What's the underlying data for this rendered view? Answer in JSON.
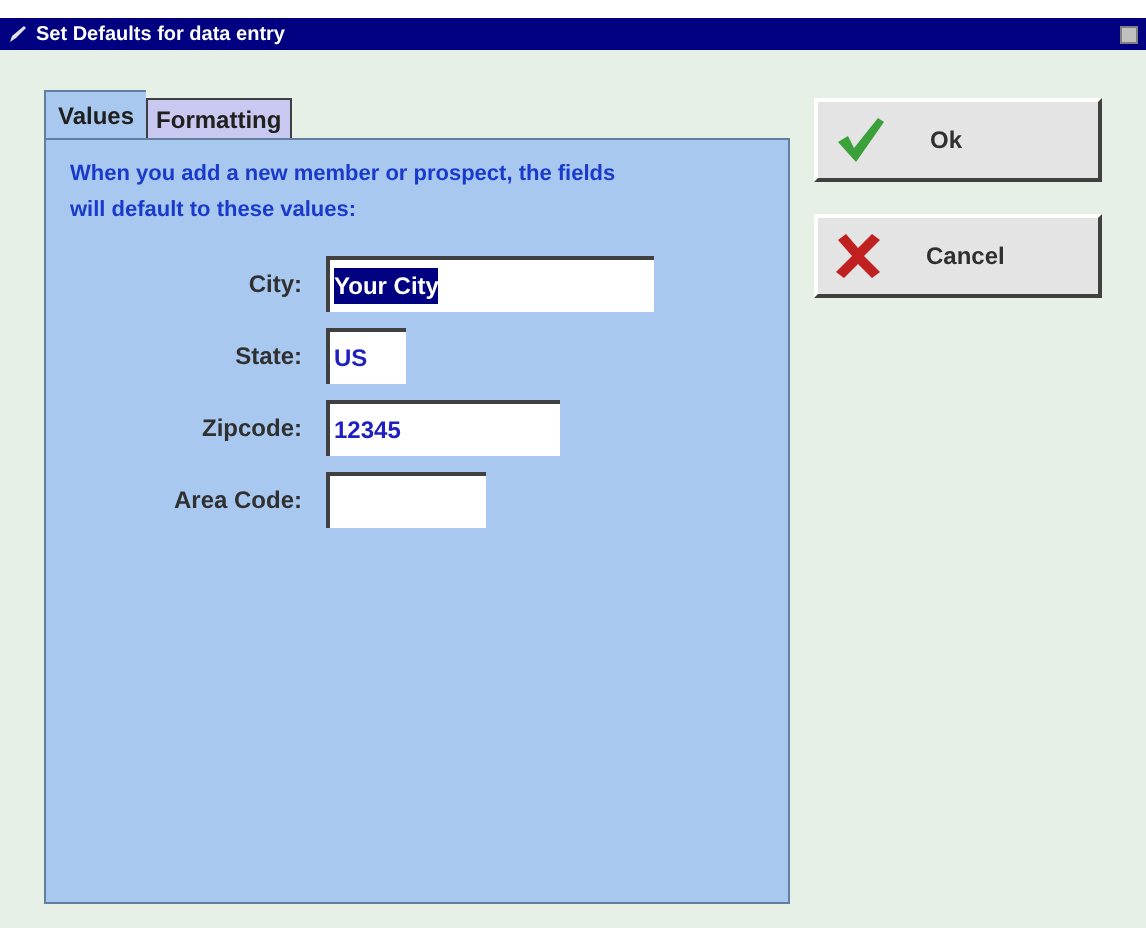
{
  "window": {
    "title": "Set Defaults for data entry"
  },
  "tabs": [
    {
      "label": "Values",
      "selected": true
    },
    {
      "label": "Formatting",
      "selected": false
    }
  ],
  "intro": "When you add a new member or prospect, the fields will default to these values:",
  "fields": [
    {
      "label": "City:",
      "value": "Your City",
      "highlighted": true
    },
    {
      "label": "State:",
      "value": "US"
    },
    {
      "label": "Zipcode:",
      "value": "12345"
    },
    {
      "label": "Area Code:"
    }
  ],
  "buttons": [
    {
      "kind": "ok",
      "label": "Ok"
    },
    {
      "kind": "cancel",
      "label": "Cancel"
    }
  ]
}
